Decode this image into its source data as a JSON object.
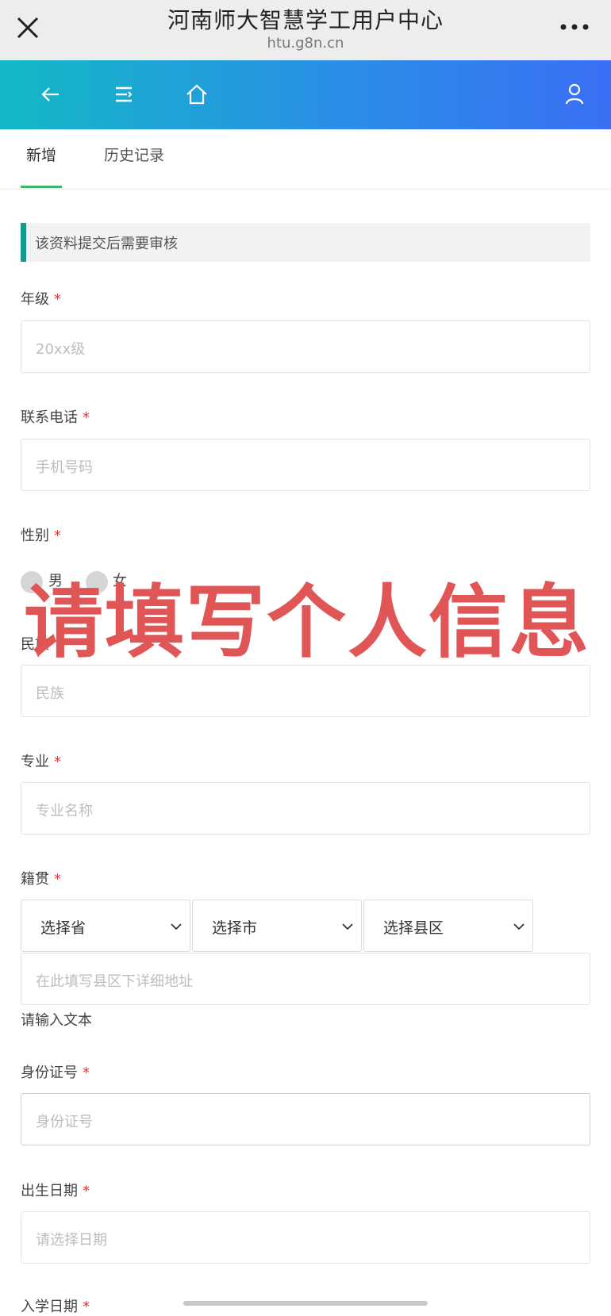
{
  "browser": {
    "title": "河南师大智慧学工用户中心",
    "url": "htu.g8n.cn"
  },
  "tabs": [
    {
      "label": "新增"
    },
    {
      "label": "历史记录"
    }
  ],
  "notice": "该资料提交后需要审核",
  "form": {
    "grade": {
      "label": "年级",
      "required": "*",
      "placeholder": "20xx级"
    },
    "phone": {
      "label": "联系电话",
      "required": "*",
      "placeholder": "手机号码"
    },
    "gender": {
      "label": "性别",
      "required": "*",
      "options": [
        "男",
        "女"
      ]
    },
    "ethnicity": {
      "label": "民族",
      "placeholder": "民族"
    },
    "major": {
      "label": "专业",
      "required": "*",
      "placeholder": "专业名称"
    },
    "origin": {
      "label": "籍贯",
      "required": "*",
      "province": "选择省",
      "city": "选择市",
      "county": "选择县区",
      "address_placeholder": "在此填写县区下详细地址",
      "hint": "请输入文本"
    },
    "id_number": {
      "label": "身份证号",
      "required": "*",
      "placeholder": "身份证号"
    },
    "birth_date": {
      "label": "出生日期",
      "required": "*",
      "placeholder": "请选择日期"
    },
    "enroll_date": {
      "label": "入学日期",
      "required": "*"
    }
  },
  "overlay_text": "请填写个人信息",
  "icons": {
    "close": "close-icon",
    "more": "more-icon",
    "back": "arrow-left-icon",
    "menu": "menu-icon",
    "home": "home-icon",
    "user": "user-icon",
    "chevron": "chevron-down-icon"
  },
  "colors": {
    "accent_green": "#3cb56e",
    "notice_bar": "#129a8c",
    "required": "#d43b3b",
    "overlay": "#e05656"
  }
}
